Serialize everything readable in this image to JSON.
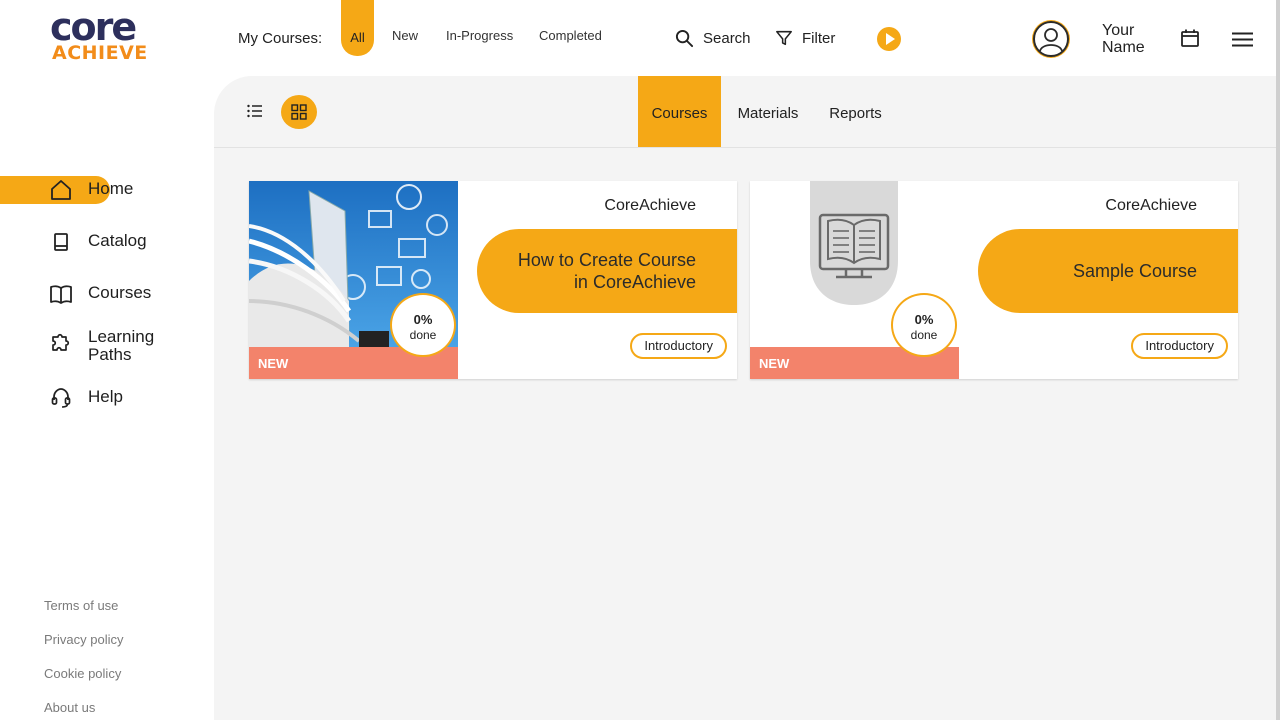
{
  "brand": {
    "logo_top": "core",
    "logo_bottom": "ACHIEVE"
  },
  "header": {
    "my_courses_label": "My Courses:",
    "filter_tabs": [
      "All",
      "New",
      "In-Progress",
      "Completed"
    ],
    "active_tab": "All",
    "search_label": "Search",
    "filter_label": "Filter",
    "user_name": "Your Name"
  },
  "sidebar": {
    "items": [
      {
        "label": "Home",
        "icon": "home-icon",
        "active": true
      },
      {
        "label": "Catalog",
        "icon": "catalog-icon"
      },
      {
        "label": "Courses",
        "icon": "book-open-icon"
      },
      {
        "label": "Learning Paths",
        "icon": "puzzle-icon"
      },
      {
        "label": "Help",
        "icon": "headset-icon"
      }
    ],
    "footer_links": [
      "Terms of use",
      "Privacy policy",
      "Cookie policy",
      "About us"
    ]
  },
  "view_tabs": [
    "Courses",
    "Materials",
    "Reports"
  ],
  "active_view_tab": "Courses",
  "courses": [
    {
      "provider": "CoreAchieve",
      "title_line1": "How to Create Course",
      "title_line2": "in CoreAchieve",
      "badge": "NEW",
      "progress_pct": "0%",
      "progress_label": "done",
      "level": "Introductory",
      "thumbnail": "book-tech-image"
    },
    {
      "provider": "CoreAchieve",
      "title_line1": "Sample Course",
      "title_line2": "",
      "badge": "NEW",
      "progress_pct": "0%",
      "progress_label": "done",
      "level": "Introductory",
      "thumbnail": "monitor-book-icon"
    }
  ],
  "colors": {
    "accent": "#f5a816",
    "new_badge": "#f3836b",
    "brand_navy": "#2d2f5c",
    "brand_orange": "#f28c1a"
  }
}
